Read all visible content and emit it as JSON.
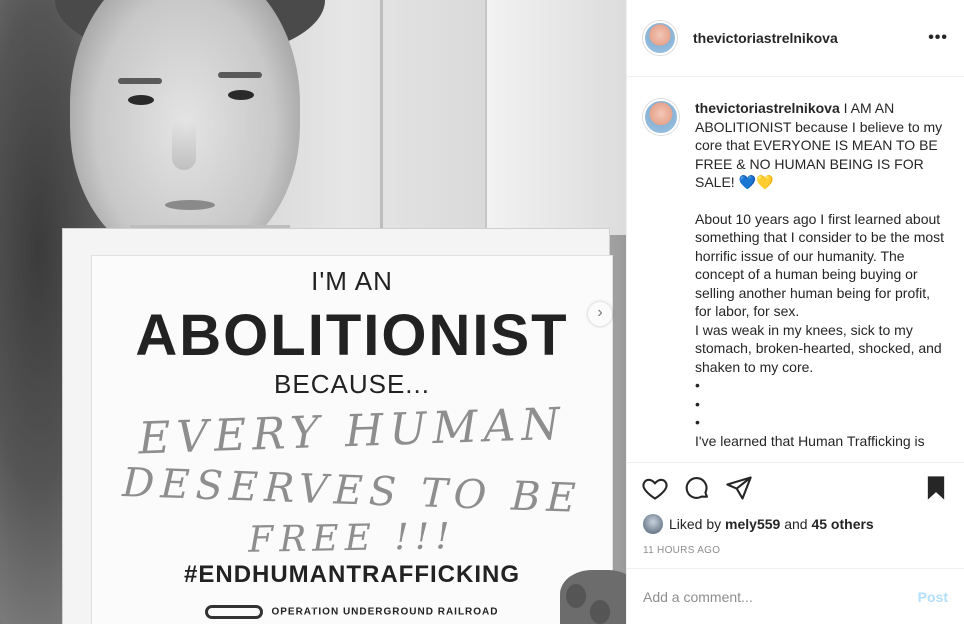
{
  "post": {
    "username": "thevictoriastrelnikova",
    "more_label": "•••",
    "image": {
      "sign_line1": "I'M AN",
      "sign_line2": "ABOLITIONIST",
      "sign_line3": "BECAUSE...",
      "handwriting_line1": "EVERY HUMAN",
      "handwriting_line2": "DESERVES TO BE",
      "handwriting_line3": "FREE !!!",
      "hashtag": "#ENDHUMANTRAFFICKING",
      "footer": "OPERATION UNDERGROUND RAILROAD",
      "next_icon": "chevron-right-icon",
      "carousel_count": 3,
      "carousel_active_index": 0
    },
    "caption": {
      "username": "thevictoriastrelnikova",
      "intro": "I AM AN ABOLITIONIST because I believe to my core that EVERYONE IS MEAN TO BE FREE & NO HUMAN BEING IS FOR SALE!",
      "emoji_blue_heart": "💙",
      "emoji_yellow_heart": "💛",
      "para1": "About 10 years ago I first learned about something that I consider to be the most horrific issue of our humanity. The concept of a human being buying or selling another human being for profit, for labor, for sex.",
      "para2": "I was weak in my knees, sick to my stomach, broken-hearted, shocked, and shaken to my core.",
      "bullet": "•",
      "para3": "I've learned that Human Trafficking is"
    },
    "actions": {
      "icons": [
        "heart-icon",
        "comment-icon",
        "share-icon",
        "bookmark-icon"
      ]
    },
    "likes": {
      "prefix": "Liked by",
      "user": "mely559",
      "middle": "and",
      "others": "45 others"
    },
    "timestamp": "11 HOURS AGO",
    "comment_box": {
      "placeholder": "Add a comment...",
      "post_label": "Post"
    }
  },
  "colors": {
    "text": "#262626",
    "muted": "#8e8e8e",
    "border": "#efefef",
    "post_disabled": "#b2dffc"
  }
}
